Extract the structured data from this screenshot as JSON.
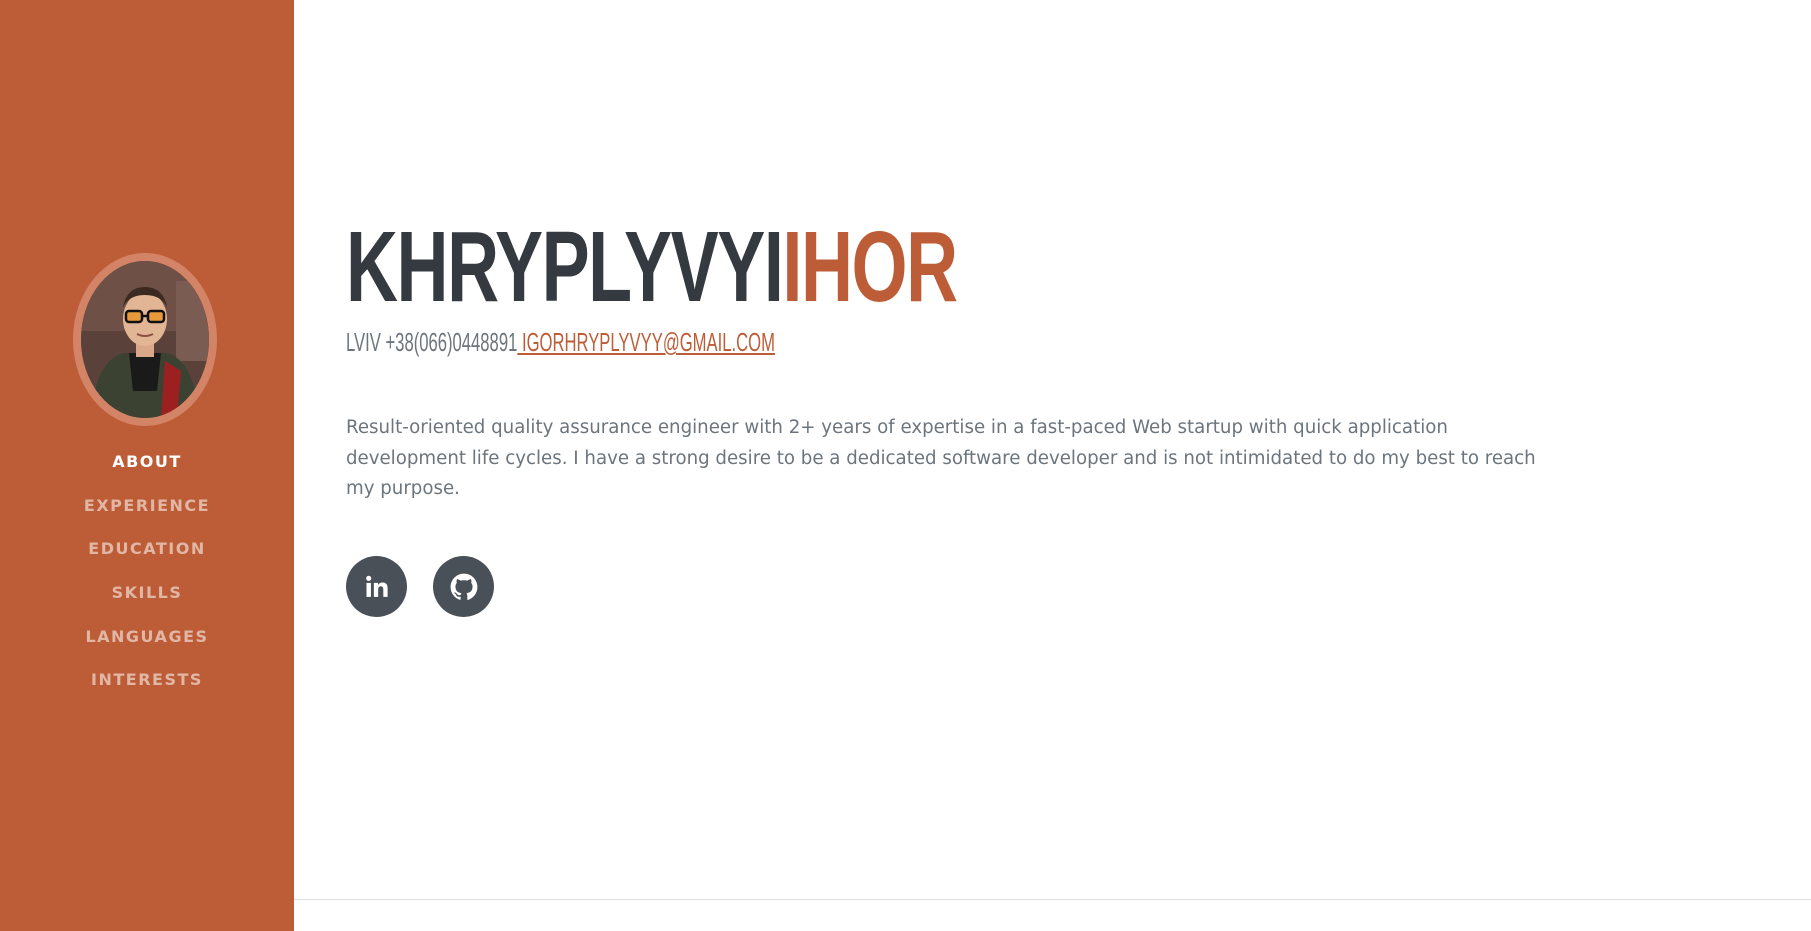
{
  "sidebar": {
    "nav": [
      {
        "label": "ABOUT",
        "active": true
      },
      {
        "label": "EXPERIENCE"
      },
      {
        "label": "EDUCATION"
      },
      {
        "label": "SKILLS"
      },
      {
        "label": "LANGUAGES"
      },
      {
        "label": "INTERESTS"
      }
    ]
  },
  "about": {
    "first_name": "KHRYPLYVYI",
    "last_name": "IHOR",
    "location": "LVIV",
    "phone": "+38(066)0448891",
    "email": " IGORHRYPLYVYY@GMAIL.COM",
    "summary": "Result-oriented quality assurance engineer with 2+ years of expertise in a fast-paced Web startup with quick application development life cycles. I have a strong desire to be a dedicated software developer and is not intimidated to do my best to reach my purpose."
  },
  "social": [
    {
      "icon": "linkedin-icon"
    },
    {
      "icon": "github-icon"
    }
  ],
  "colors": {
    "accent": "#bd5d38",
    "name_dark": "#343a40",
    "text_muted": "#6c757d",
    "social_bg": "#495057"
  }
}
